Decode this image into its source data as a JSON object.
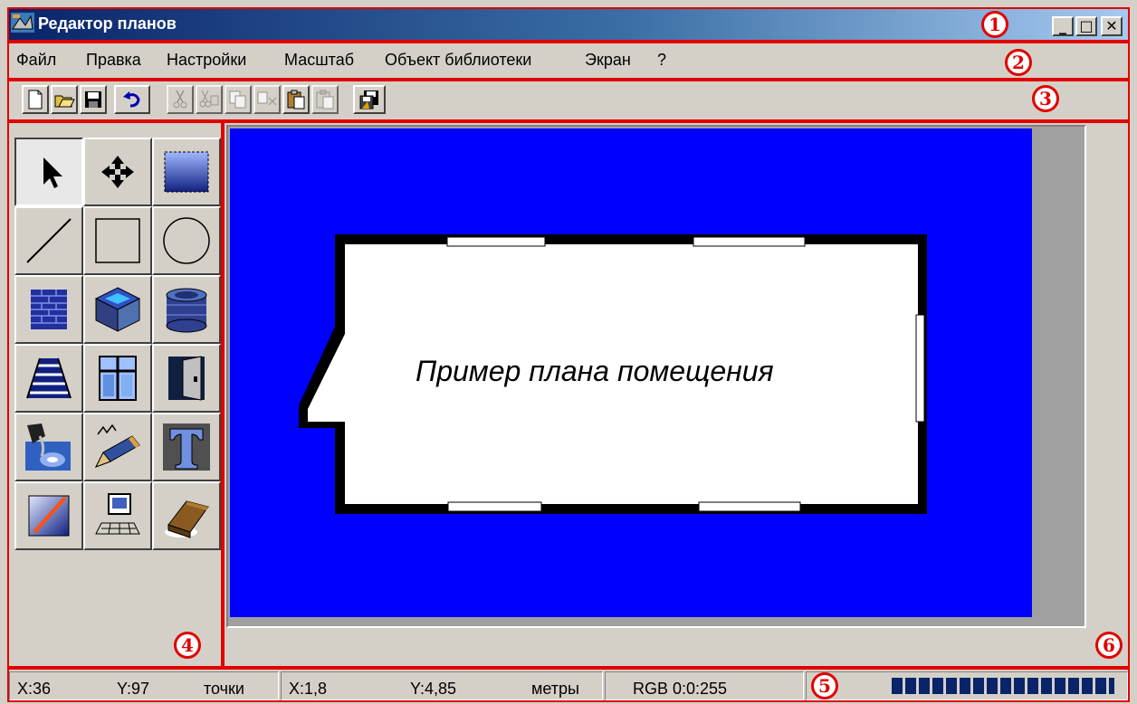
{
  "window": {
    "title": "Редактор планов",
    "controls": {
      "minimize": "_",
      "maximize": "□",
      "close": "✕"
    }
  },
  "menu": {
    "items": [
      {
        "label": "Файл"
      },
      {
        "label": "Правка"
      },
      {
        "label": "Настройки"
      },
      {
        "label": "Масштаб"
      },
      {
        "label": "Объект библиотеки"
      },
      {
        "label": "Экран"
      },
      {
        "label": "?"
      }
    ]
  },
  "toolbar": {
    "buttons": [
      {
        "icon": "new-document-icon",
        "enabled": true
      },
      {
        "icon": "open-folder-icon",
        "enabled": true
      },
      {
        "icon": "save-disk-icon",
        "enabled": true
      },
      {
        "icon": "undo-icon",
        "enabled": true
      },
      {
        "icon": "cut-icon",
        "enabled": false
      },
      {
        "icon": "cut-special-icon",
        "enabled": false
      },
      {
        "icon": "copy-icon",
        "enabled": false
      },
      {
        "icon": "copy-special-icon",
        "enabled": false
      },
      {
        "icon": "paste-icon",
        "enabled": true
      },
      {
        "icon": "paste-special-icon",
        "enabled": false
      },
      {
        "icon": "save-as-library-icon",
        "enabled": true
      }
    ]
  },
  "palette": {
    "tools": [
      {
        "icon": "select-arrow-icon",
        "selected": true
      },
      {
        "icon": "move-arrows-icon",
        "selected": false
      },
      {
        "icon": "fill-gradient-icon",
        "selected": false
      },
      {
        "icon": "line-tool-icon",
        "selected": false
      },
      {
        "icon": "rectangle-tool-icon",
        "selected": false
      },
      {
        "icon": "circle-tool-icon",
        "selected": false
      },
      {
        "icon": "brick-wall-icon",
        "selected": false
      },
      {
        "icon": "wall-box-icon",
        "selected": false
      },
      {
        "icon": "wall-cylinder-icon",
        "selected": false
      },
      {
        "icon": "stairs-icon",
        "selected": false
      },
      {
        "icon": "window-icon",
        "selected": false
      },
      {
        "icon": "door-icon",
        "selected": false
      },
      {
        "icon": "paint-bucket-icon",
        "selected": false
      },
      {
        "icon": "pencil-icon",
        "selected": false
      },
      {
        "icon": "text-tool-icon",
        "selected": false
      },
      {
        "icon": "color-gradient-icon",
        "selected": false
      },
      {
        "icon": "computer-object-icon",
        "selected": false
      },
      {
        "icon": "eraser-icon",
        "selected": false
      }
    ]
  },
  "canvas": {
    "background_color": "#0000ff",
    "room_label": "Пример плана помещения"
  },
  "status": {
    "px_x": "X:36",
    "px_y": "Y:97",
    "px_unit": "точки",
    "m_x": "X:1,8",
    "m_y": "Y:4,85",
    "m_unit": "метры",
    "rgb": "RGB 0:0:255",
    "progress": 1.0
  },
  "annotations": [
    "1",
    "2",
    "3",
    "4",
    "5",
    "6"
  ],
  "colors": {
    "annotation": "#e00000",
    "title_gradient_start": "#0a246a",
    "title_gradient_end": "#a6caf0",
    "progress_fill": "#0a246a"
  }
}
